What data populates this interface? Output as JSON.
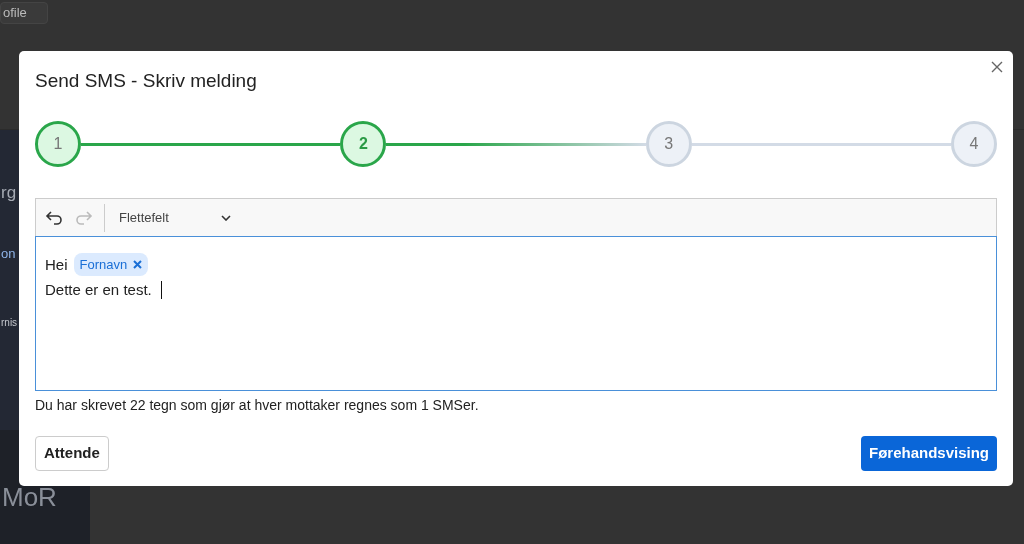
{
  "background": {
    "profile_button": "ofile",
    "sidebar_texts": [
      "rg",
      "on",
      "rnis"
    ],
    "logo": "MoR"
  },
  "dialog": {
    "title": "Send SMS - Skriv melding"
  },
  "steps": [
    {
      "label": "1",
      "done": true,
      "selected": false
    },
    {
      "label": "2",
      "done": false,
      "selected": true
    },
    {
      "label": "3",
      "done": false,
      "selected": false
    },
    {
      "label": "4",
      "done": false,
      "selected": false
    }
  ],
  "editor": {
    "undo_disabled": false,
    "redo_disabled": true,
    "merge_field_select": "Flettefelt",
    "focused": true,
    "lines": [
      [
        {
          "kind": "text",
          "text": "Hei"
        },
        {
          "kind": "tag",
          "text": "Fornavn"
        }
      ],
      [
        {
          "kind": "text",
          "text": "Dette er en test."
        }
      ]
    ]
  },
  "counter_text": "Du har skrevet 22 tegn som gjør at hver mottaker regnes som 1 SMSer.",
  "buttons": {
    "back": "Attende",
    "next": "Førehandsvising"
  }
}
